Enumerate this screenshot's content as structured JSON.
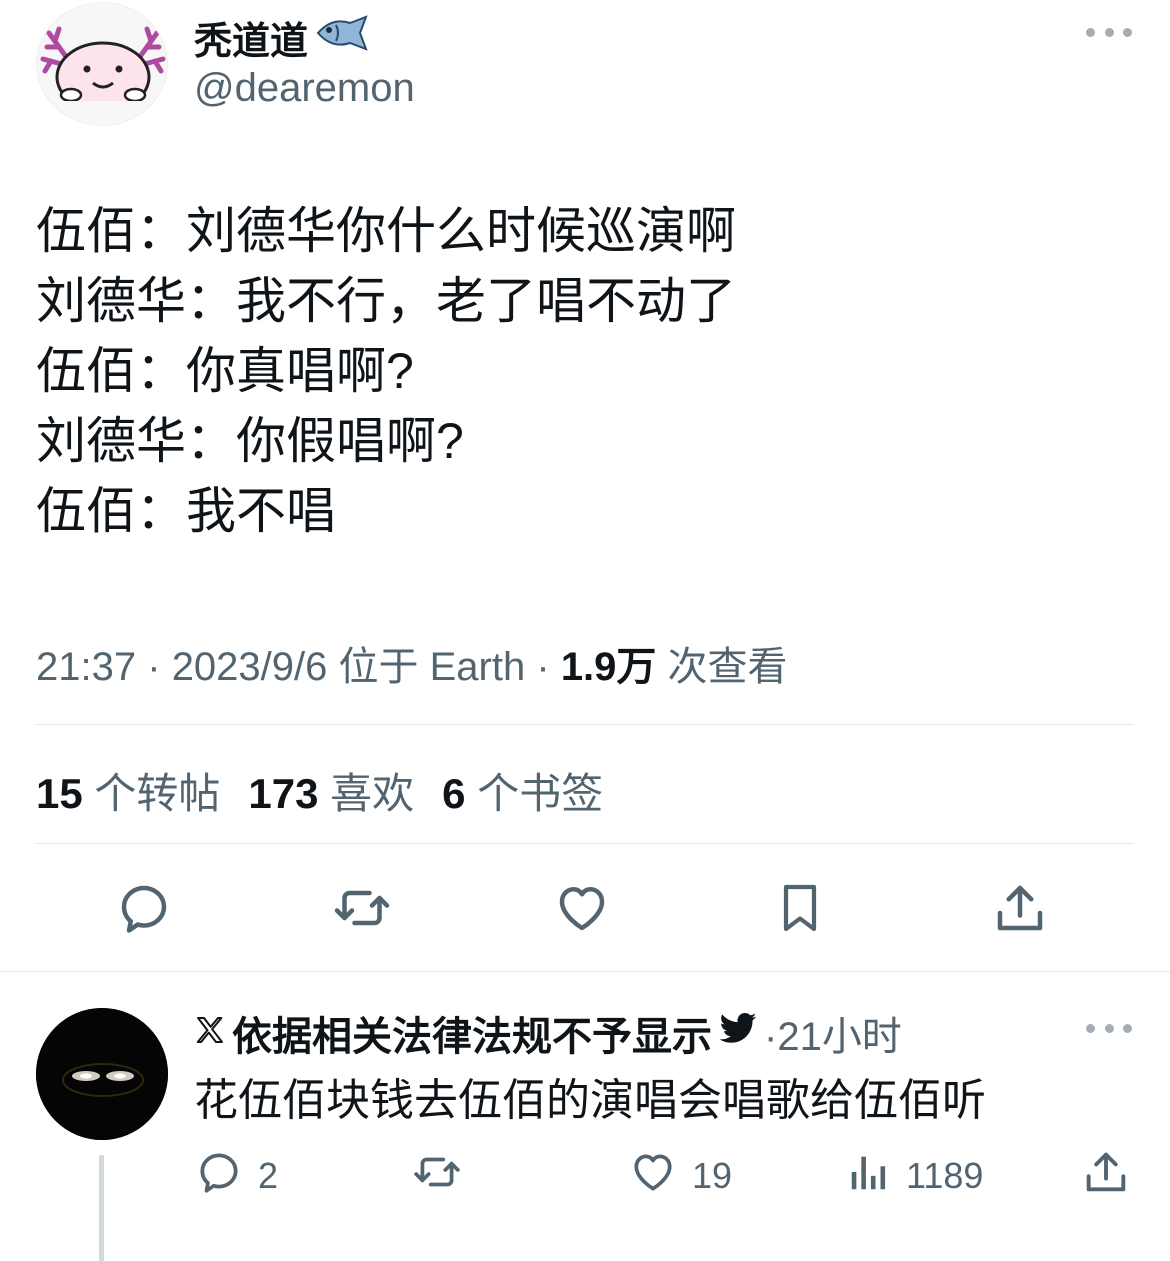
{
  "author": {
    "name": "秃道道",
    "handle": "@dearemon"
  },
  "tweet": {
    "lines": [
      "伍佰：刘德华你什么时候巡演啊",
      "刘德华：我不行，老了唱不动了",
      "伍佰：你真唱啊?",
      "刘德华：你假唱啊?",
      "伍佰：我不唱"
    ],
    "time": "21:37",
    "date": "2023/9/6",
    "location": "位于 Earth",
    "views_count": "1.9万",
    "views_label": "次查看",
    "separator": "·"
  },
  "stats": {
    "retweets_count": "15",
    "retweets_label": "个转帖",
    "likes_count": "173",
    "likes_label": "喜欢",
    "bookmarks_count": "6",
    "bookmarks_label": "个书签"
  },
  "actions": [
    "reply-icon",
    "retweet-icon",
    "heart-icon",
    "bookmark-icon",
    "share-icon"
  ],
  "reply": {
    "name": "依据相关法律法规不予显示",
    "time": "·21小时",
    "text": "花伍佰块钱去伍佰的演唱会唱歌给伍佰听",
    "replies": "2",
    "likes": "19",
    "views": "1189"
  },
  "colors": {
    "primary_text": "#0f1419",
    "secondary_text": "#536471",
    "divider": "#e6e9eb"
  }
}
